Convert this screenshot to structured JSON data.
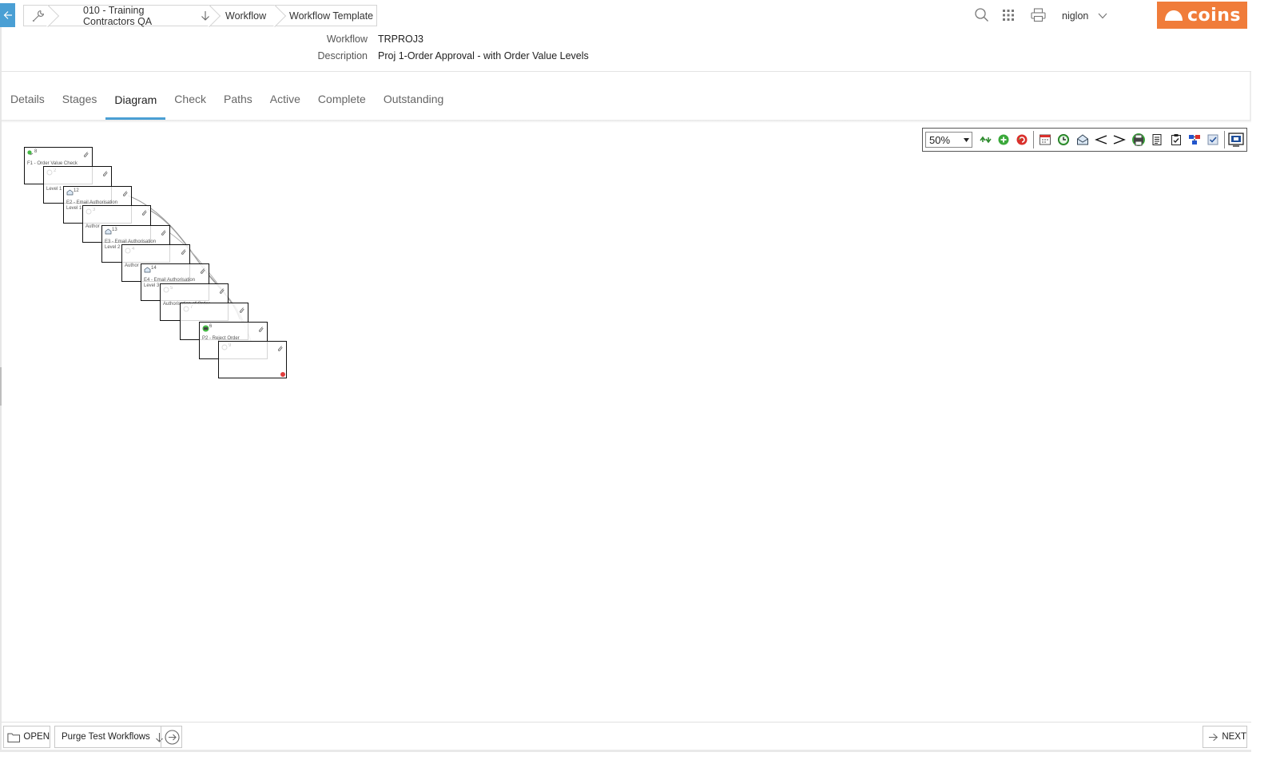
{
  "breadcrumb": {
    "company": "010 - Training Contractors QA",
    "workflow": "Workflow",
    "template": "Workflow Template"
  },
  "user": {
    "name": "niglon"
  },
  "brand": {
    "logo_text": "coins",
    "color": "#f07c3a",
    "accent": "#4a9fd4"
  },
  "header": {
    "workflow_label": "Workflow",
    "workflow_value": "TRPROJ3",
    "description_label": "Description",
    "description_value": "Proj 1-Order Approval - with Order Value Levels"
  },
  "tabs": [
    {
      "label": "Details",
      "active": false
    },
    {
      "label": "Stages",
      "active": false
    },
    {
      "label": "Diagram",
      "active": true
    },
    {
      "label": "Check",
      "active": false
    },
    {
      "label": "Paths",
      "active": false
    },
    {
      "label": "Active",
      "active": false
    },
    {
      "label": "Complete",
      "active": false
    },
    {
      "label": "Outstanding",
      "active": false
    }
  ],
  "toolbar": {
    "zoom": "50%",
    "icons": [
      "undo-redo-icon",
      "add-stage-icon",
      "refresh-icon",
      "calendar-icon",
      "clock-icon",
      "email-icon",
      "branch-left-icon",
      "branch-right-icon",
      "printer-icon",
      "document-icon",
      "checklist-icon",
      "flow-chart-icon",
      "checkbox-icon",
      "fullscreen-icon"
    ]
  },
  "diagram": {
    "nodes": [
      {
        "id": "8",
        "label": "F1 - Order Value Check",
        "icon": "start-icon"
      },
      {
        "id": "2",
        "label": "Level 1",
        "icon": "stage-icon"
      },
      {
        "id": "12",
        "label": "E2 - Email Authorisation Level 1",
        "icon": "email-icon"
      },
      {
        "id": "3",
        "label": "Author",
        "icon": "stage-icon"
      },
      {
        "id": "13",
        "label": "E3 - Email Authorisation Level 2",
        "icon": "email-icon"
      },
      {
        "id": "4",
        "label": "Author",
        "icon": "stage-icon"
      },
      {
        "id": "14",
        "label": "E4 - Email Authorisation Level 3",
        "icon": "email-icon"
      },
      {
        "id": "5",
        "label": "Authorisation of Order",
        "icon": "stage-icon"
      },
      {
        "id": "7",
        "label": "",
        "icon": "stage-icon"
      },
      {
        "id": "6",
        "label": "P2 - Reject Order",
        "icon": "process-icon"
      },
      {
        "id": "9",
        "label": "",
        "icon": "end-icon"
      }
    ]
  },
  "footer": {
    "open_label": "OPEN",
    "purge_label": "Purge Test Workflows",
    "next_label": "NEXT"
  }
}
